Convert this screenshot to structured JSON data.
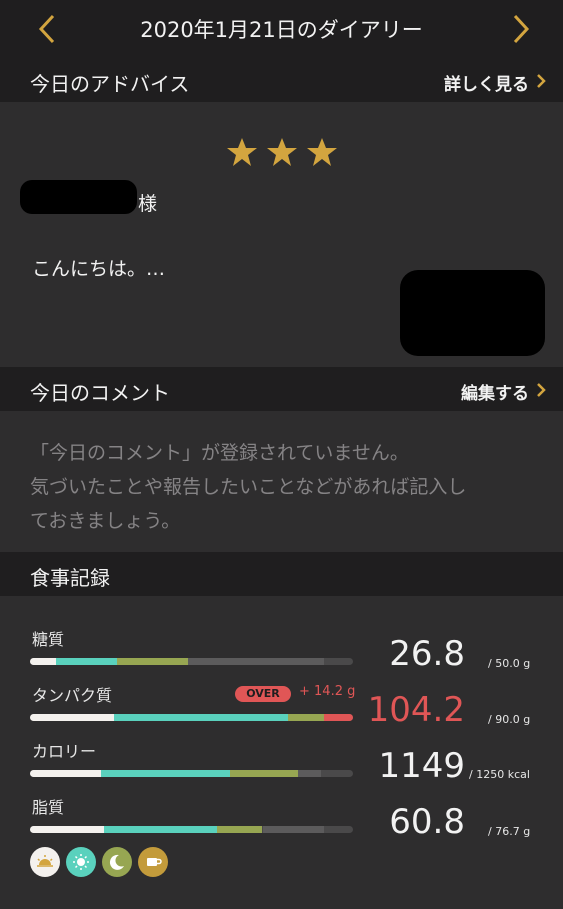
{
  "header": {
    "title": "2020年1月21日のダイアリー"
  },
  "advice": {
    "section_title": "今日のアドバイス",
    "link_label": "詳しく見る",
    "rating": 3,
    "honorific": "様",
    "greeting": "こんにちは。…"
  },
  "comment": {
    "section_title": "今日のコメント",
    "link_label": "編集する",
    "placeholder_lines": [
      "「今日のコメント」が登録されていません。",
      "気づいたことや報告したいことなどがあれば記入し",
      "ておきましょう。"
    ]
  },
  "meals": {
    "section_title": "食事記録",
    "nutrients": [
      {
        "label": "糖質",
        "value": "26.8",
        "unit": "/ 50.0 g",
        "segments": [
          0.08,
          0.19,
          0.22,
          0.42
        ],
        "over": false
      },
      {
        "label": "タンパク質",
        "value": "104.2",
        "unit": "/ 90.0 g",
        "segments": [
          0.26,
          0.54,
          0.11,
          0.0
        ],
        "over": true,
        "over_label": "OVER",
        "over_amount": "+ 14.2 g"
      },
      {
        "label": "カロリー",
        "value": "1149",
        "unit": "/ 1250 kcal",
        "segments": [
          0.22,
          0.4,
          0.21,
          0.07
        ],
        "over": false
      },
      {
        "label": "脂質",
        "value": "60.8",
        "unit": "/ 76.7 g",
        "segments": [
          0.23,
          0.35,
          0.14,
          0.19
        ],
        "over": false
      }
    ],
    "meal_icons": [
      {
        "name": "sunrise-icon",
        "color": "#f4f1ee"
      },
      {
        "name": "sun-icon",
        "color": "#5ad1bd"
      },
      {
        "name": "moon-icon",
        "color": "#97a652"
      },
      {
        "name": "cup-icon",
        "color": "#c39b3b"
      }
    ]
  },
  "colors": {
    "accent_gold": "#d3a53f",
    "seg_white": "#f4f1ee",
    "seg_teal": "#5ad1bd",
    "seg_olive": "#97a652",
    "seg_over": "#e05656",
    "seg_rest": "#4a494a"
  }
}
